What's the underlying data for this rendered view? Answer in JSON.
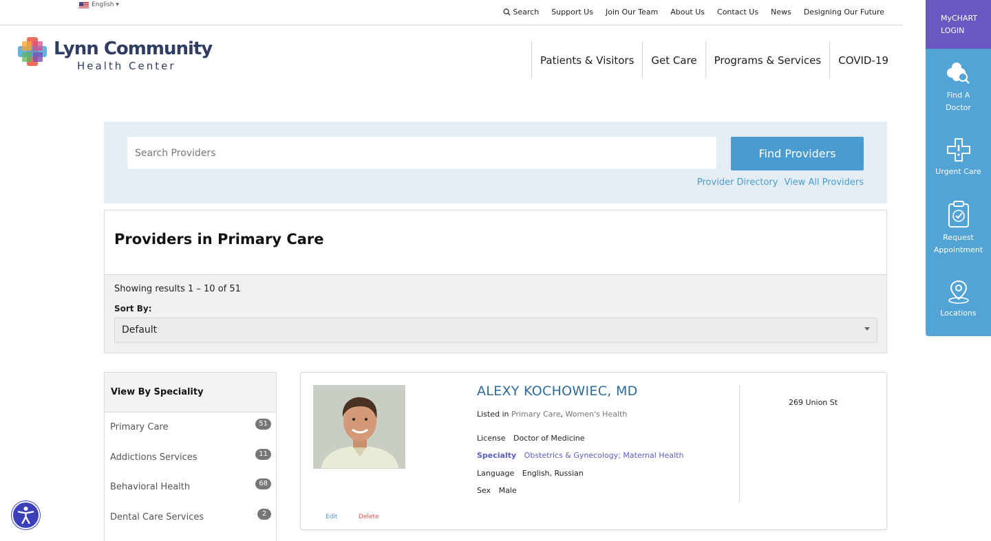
{
  "topbar": {
    "language": "English ▾",
    "links": [
      "Search",
      "Support Us",
      "Join Our Team",
      "About Us",
      "Contact Us",
      "News",
      "Designing Our Future"
    ]
  },
  "logo": {
    "line1": "Lynn Community",
    "line2": "Health Center"
  },
  "main_nav": [
    "Patients & Visitors",
    "Get Care",
    "Programs & Services",
    "COVID-19"
  ],
  "sidebar": {
    "mychart_line1": "MyCHART",
    "mychart_line2": "LOGIN",
    "items": [
      {
        "line1": "Find A",
        "line2": "Doctor",
        "icon": "find-doctor-icon"
      },
      {
        "line1": "Urgent Care",
        "line2": "",
        "icon": "urgent-care-icon"
      },
      {
        "line1": "Request",
        "line2": "Appointment",
        "icon": "clipboard-icon"
      },
      {
        "line1": "Locations",
        "line2": "",
        "icon": "location-pin-icon"
      }
    ]
  },
  "search": {
    "placeholder": "Search Providers",
    "button_label": "Find Providers",
    "link_directory": "Provider Directory",
    "link_view_all": "View All Providers"
  },
  "results": {
    "title": "Providers in Primary Care",
    "showing": "Showing results 1 – 10 of 51",
    "sort_label": "Sort By:",
    "sort_value": "Default"
  },
  "specialty": {
    "heading": "View By Speciality",
    "items": [
      {
        "label": "Primary Care",
        "count": "51"
      },
      {
        "label": "Addictions Services",
        "count": "11"
      },
      {
        "label": "Behavioral Health",
        "count": "68"
      },
      {
        "label": "Dental Care Services",
        "count": "2"
      }
    ]
  },
  "provider": {
    "name": "ALEXY KOCHOWIEC, MD",
    "listed_prefix": "Listed in",
    "listed_1": "Primary Care",
    "listed_sep": ",",
    "listed_2": "Women's Health",
    "license_label": "License",
    "license_value": "Doctor of Medicine",
    "specialty_label": "Specialty",
    "specialty_value": "Obstetrics & Gynecology; Maternal Health",
    "language_label": "Language",
    "language_value": "English, Russian",
    "sex_label": "Sex",
    "sex_value": "Male",
    "address": "269 Union St",
    "edit_label": "Edit",
    "delete_label": "Delete"
  },
  "colors": {
    "sidebar_blue": "#52a3d6",
    "mychart_purple": "#6c58c2",
    "link_blue": "#4a9cd0",
    "delete_red": "#d9534f"
  }
}
